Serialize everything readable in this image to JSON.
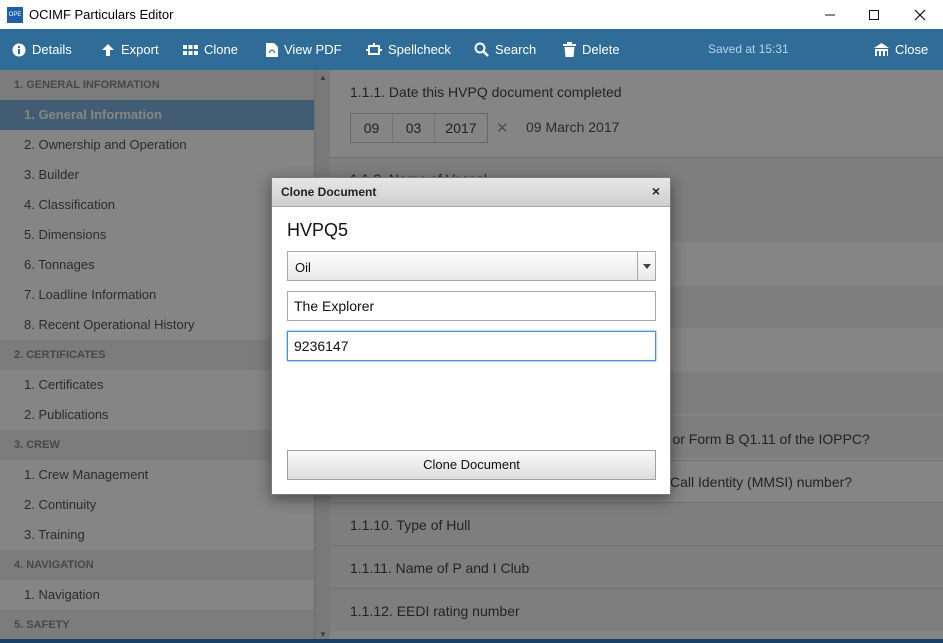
{
  "window": {
    "title": "OCIMF Particulars Editor",
    "icon_label": "OPE"
  },
  "toolbar": {
    "buttons": [
      {
        "label": "Details",
        "icon": "info-icon"
      },
      {
        "label": "Export",
        "icon": "export-arrow-icon"
      },
      {
        "label": "Clone",
        "icon": "grid-icon"
      },
      {
        "label": "View PDF",
        "icon": "pdf-icon"
      },
      {
        "label": "Spellcheck",
        "icon": "spellcheck-icon"
      },
      {
        "label": "Search",
        "icon": "search-icon"
      },
      {
        "label": "Delete",
        "icon": "trash-icon"
      }
    ],
    "saved_status": "Saved at 15:31",
    "close_label": "Close"
  },
  "sidebar": {
    "sections": [
      {
        "header": "1. GENERAL INFORMATION",
        "items": [
          "1. General Information",
          "2. Ownership and Operation",
          "3. Builder",
          "4. Classification",
          "5. Dimensions",
          "6. Tonnages",
          "7. Loadline Information",
          "8. Recent Operational History"
        ]
      },
      {
        "header": "2. CERTIFICATES",
        "items": [
          "1. Certificates",
          "2. Publications"
        ]
      },
      {
        "header": "3. CREW",
        "items": [
          "1. Crew Management",
          "2. Continuity",
          "3. Training"
        ]
      },
      {
        "header": "4. NAVIGATION",
        "items": [
          "1. Navigation"
        ]
      },
      {
        "header": "5. SAFETY",
        "items": []
      }
    ],
    "active_item": "1. General Information"
  },
  "content": {
    "q1_title": "1.1.1. Date this HVPQ document completed",
    "date": {
      "day": "09",
      "month": "03",
      "year": "2017",
      "display": "09 March 2017"
    },
    "q2_partial": "1.1.2. Name of Vessel",
    "q8_partial": "A or Form B Q1.11 of the IOPPC?",
    "q9_partial": "Call Identity (MMSI) number?",
    "q10": "1.1.10. Type of Hull",
    "q11": "1.1.11. Name of P and I Club",
    "q12": "1.1.12. EEDI rating number"
  },
  "dialog": {
    "title": "Clone Document",
    "document_name": "HVPQ5",
    "type_select_value": "Oil",
    "vessel_name_value": "The Explorer",
    "imo_value": "9236147",
    "clone_button_label": "Clone Document"
  }
}
